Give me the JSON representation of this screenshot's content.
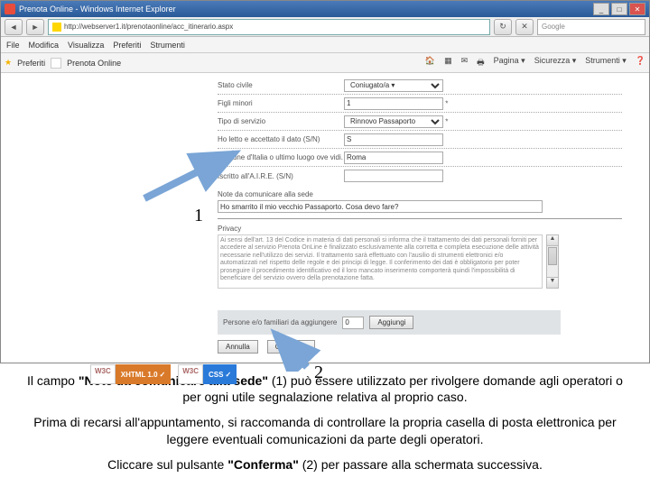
{
  "browser": {
    "title": "Prenota Online - Windows Internet Explorer",
    "address": "http://webserver1.it/prenotaonline/acc_itinerario.aspx",
    "search_placeholder": "Google",
    "menu": {
      "file": "File",
      "modifica": "Modifica",
      "visualizza": "Visualizza",
      "preferiti": "Preferiti",
      "strumenti": "Strumenti"
    },
    "favorites_label": "Preferiti",
    "tab_label": "Prenota Online",
    "tools": {
      "pagina": "Pagina ▾",
      "sicurezza": "Sicurezza ▾",
      "strumenti": "Strumenti ▾"
    }
  },
  "form": {
    "row1_label": "Stato civile",
    "row1_value": "Coniugato/a ▾",
    "row2_label": "Figli minori",
    "row2_value": "1",
    "row3_label": "Tipo di servizio",
    "row3_value": "Rinnovo Passaporto",
    "row4_label": "Ho letto e accettato il dato (S/N)",
    "row4_value": "S",
    "row5_label": "Comune d'Italia o ultimo luogo ove vidi.",
    "row5_value": "Roma",
    "row6_label": "Iscritto all'A.I.R.E. (S/N)",
    "row6_value": "",
    "note_label": "Note da comunicare alla sede",
    "note_value": "Ho smarrito il mio vecchio Passaporto. Cosa devo fare?",
    "privacy_label": "Privacy",
    "privacy_text": "Ai sensi dell'art. 13 del Codice in materia di dati personali si informa che il trattamento dei dati personali forniti per accedere al servizio Prenota OnLine è finalizzato esclusivamente alla corretta e completa esecuzione delle attività necessarie nell'utilizzo dei servizi. Il trattamento sarà effettuato con l'ausilio di strumenti elettronici e/o automatizzati nel rispetto delle regole e dei principi di legge. Il conferimento dei dati è obbligatorio per poter proseguire il procedimento identificativo ed il loro mancato inserimento comporterà quindi l'impossibilità di beneficiare del servizio ovvero della prenotazione fatta.",
    "listadd_label": "Persone e/o familiari da aggiungere",
    "listadd_num": "0",
    "listadd_btn": "Aggiungi",
    "btn_cancel": "Annulla",
    "btn_confirm": "Conferma"
  },
  "callout": {
    "n1": "1",
    "n2": "2"
  },
  "badges": {
    "w3c": "W3C",
    "xhtml": "XHTML 1.0",
    "css": "CSS"
  },
  "instructions": {
    "p1a": "Il campo ",
    "p1b": "\"Note da comunicare alla sede\"",
    "p1c": " (1) può essere utilizzato per rivolgere domande agli operatori o per ogni utile segnalazione relativa al proprio caso.",
    "p2": "Prima di recarsi all'appuntamento, si raccomanda di controllare la propria casella di posta elettronica per leggere eventuali comunicazioni da parte degli operatori.",
    "p3a": "Cliccare sul pulsante ",
    "p3b": "\"Conferma\"",
    "p3c": " (2) per passare alla schermata successiva."
  }
}
